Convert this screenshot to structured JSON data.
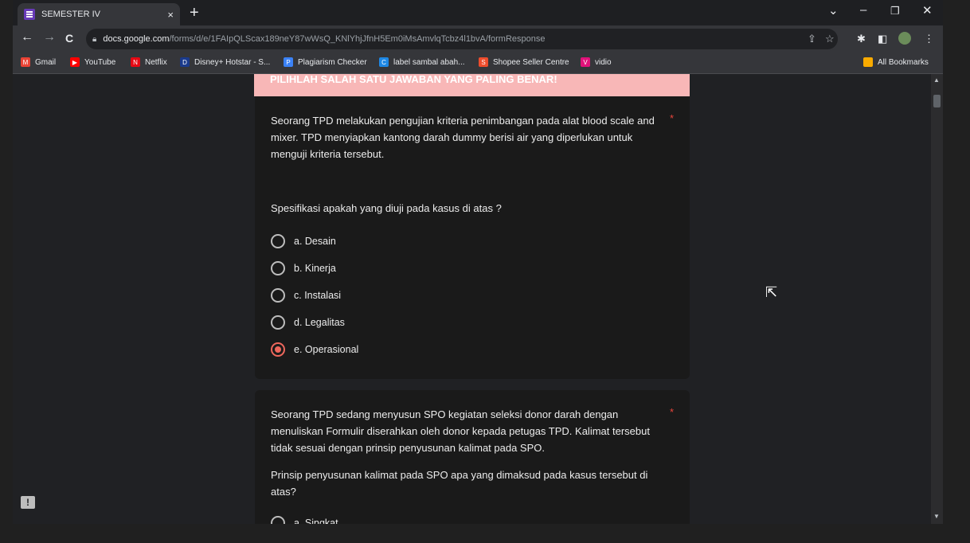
{
  "tab": {
    "title": "SEMESTER IV",
    "close": "×",
    "new": "+"
  },
  "window_controls": {
    "dropdown": "⌄",
    "minimize": "–",
    "restore": "❐",
    "close": "✕"
  },
  "toolbar": {
    "back": "←",
    "forward": "→",
    "reload": "C",
    "url_host": "docs.google.com",
    "url_path": "/forms/d/e/1FAIpQLScax189neY87wWsQ_KNlYhjJfnH5Em0iMsAmvlqTcbz4l1bvA/formResponse"
  },
  "bookmarks": [
    {
      "label": "Gmail",
      "color": "#ea4335",
      "glyph": "M"
    },
    {
      "label": "YouTube",
      "color": "#ff0000",
      "glyph": "▶"
    },
    {
      "label": "Netflix",
      "color": "#e50914",
      "glyph": "N"
    },
    {
      "label": "Disney+ Hotstar - S...",
      "color": "#1a3a8c",
      "glyph": "D"
    },
    {
      "label": "Plagiarism Checker",
      "color": "#3b82f6",
      "glyph": "P"
    },
    {
      "label": "label sambal abah...",
      "color": "#1e88e5",
      "glyph": "C"
    },
    {
      "label": "Shopee Seller Centre",
      "color": "#ee4d2d",
      "glyph": "S"
    },
    {
      "label": "vidio",
      "color": "#e1127a",
      "glyph": "V"
    }
  ],
  "all_bookmarks": "All Bookmarks",
  "banner": "PILIHLAH SALAH SATU JAWABAN YANG PALING BENAR!",
  "question1": {
    "text": "Seorang TPD melakukan pengujian kriteria penimbangan pada alat blood scale and mixer. TPD menyiapkan kantong darah dummy berisi air yang diperlukan untuk menguji kriteria tersebut.",
    "prompt": "Spesifikasi apakah yang diuji pada kasus di atas ?",
    "required": "*",
    "options": [
      "a. Desain",
      "b. Kinerja",
      "c. Instalasi",
      "d. Legalitas",
      "e. Operasional"
    ],
    "selected_index": 4
  },
  "question2": {
    "text": "Seorang TPD sedang menyusun SPO kegiatan seleksi donor darah dengan menuliskan Formulir diserahkan oleh donor kepada petugas TPD. Kalimat tersebut tidak sesuai dengan prinsip penyusunan kalimat pada SPO.",
    "prompt": "Prinsip penyusunan kalimat pada SPO apa yang dimaksud pada kasus tersebut di atas?",
    "required": "*",
    "first_option": "a. Singkat"
  },
  "colors": {
    "accent_checked": "#ee675c",
    "banner": "#f8b7b7",
    "required": "#e8453c"
  }
}
